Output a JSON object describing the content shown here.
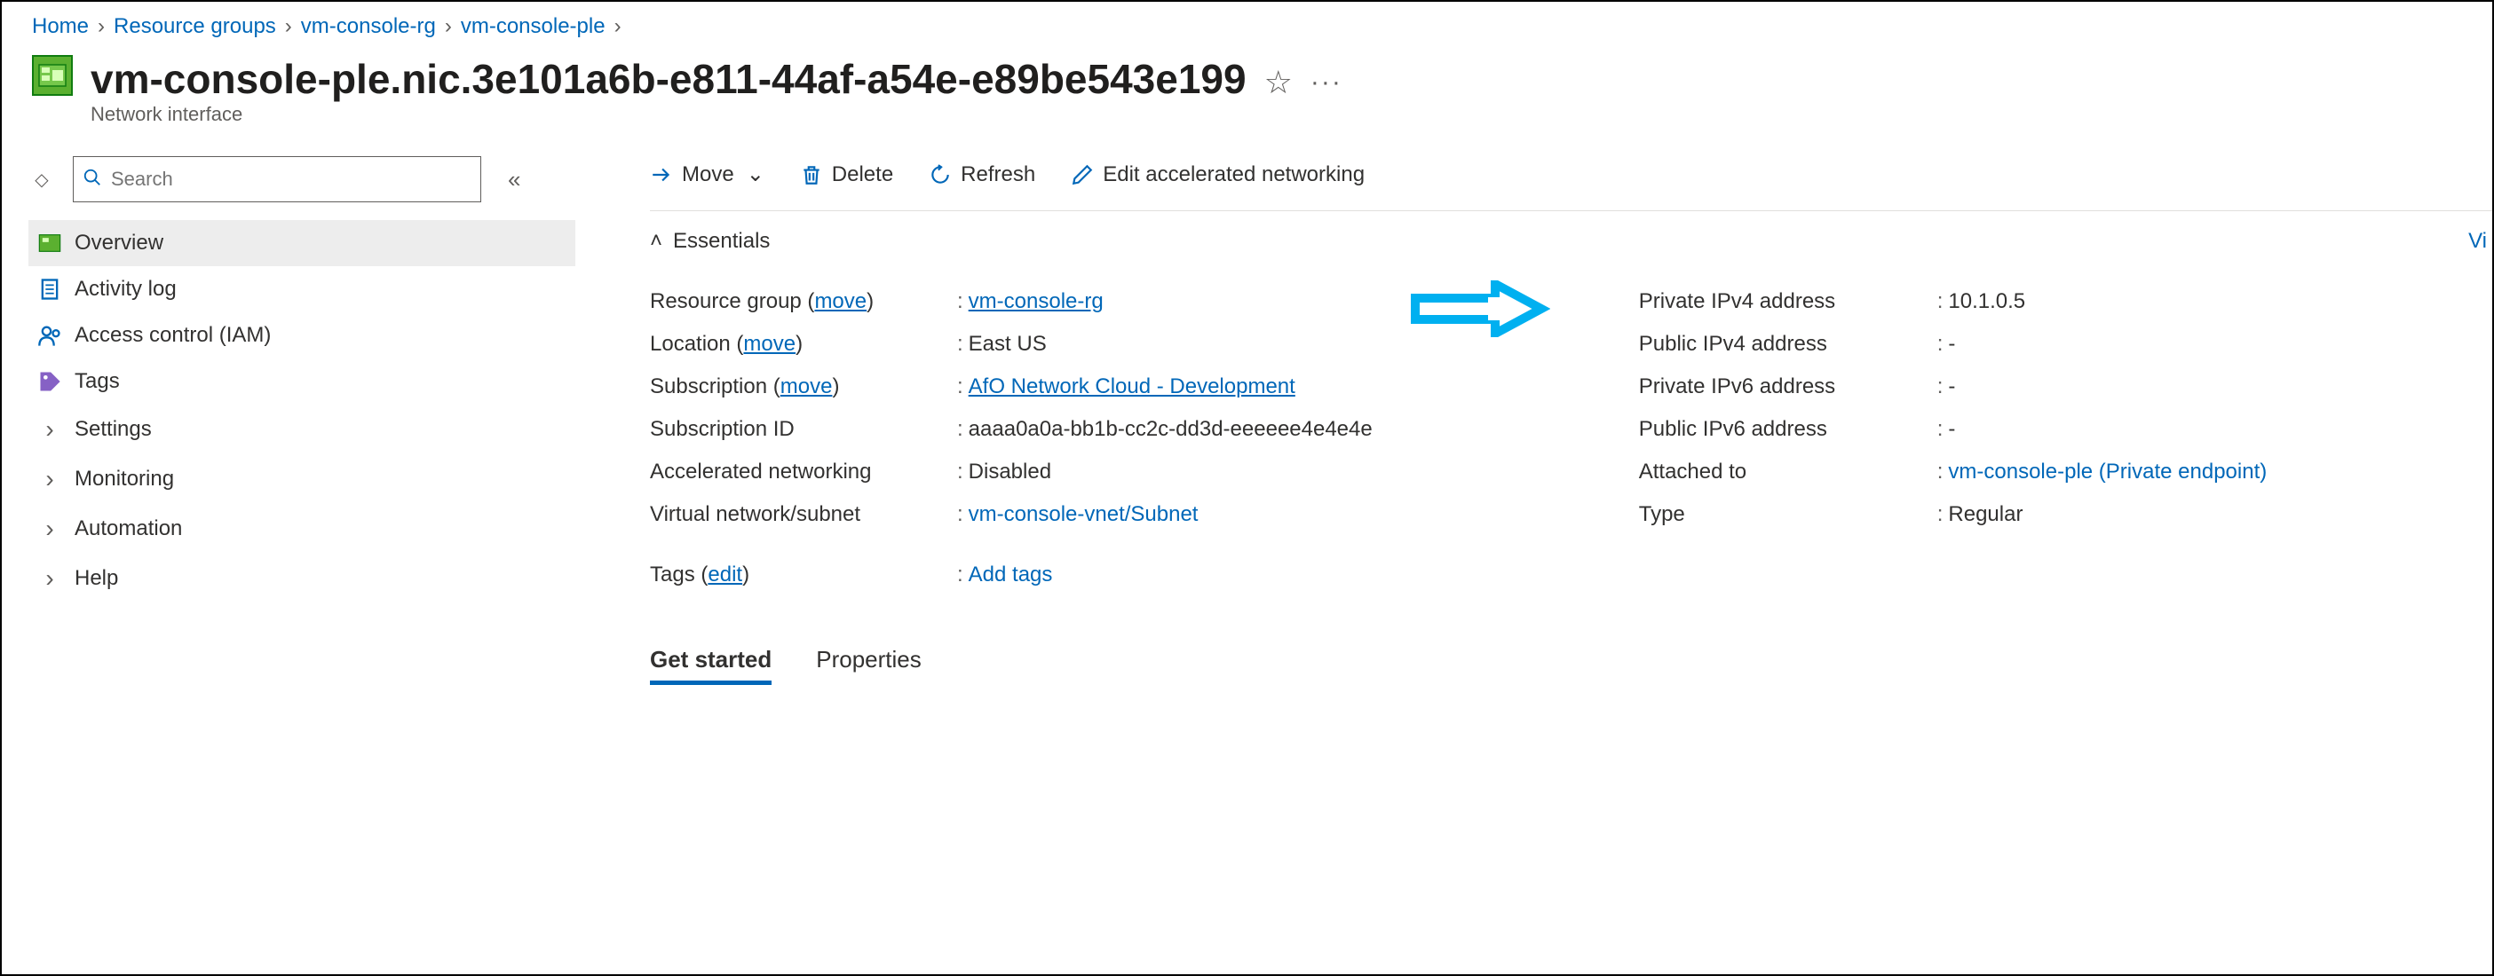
{
  "breadcrumb": [
    {
      "label": "Home"
    },
    {
      "label": "Resource groups"
    },
    {
      "label": "vm-console-rg"
    },
    {
      "label": "vm-console-ple"
    }
  ],
  "title": "vm-console-ple.nic.3e101a6b-e811-44af-a54e-e89be543e199",
  "subtitle": "Network interface",
  "sidebar": {
    "search_placeholder": "Search",
    "items": [
      {
        "label": "Overview",
        "icon": "nic-icon"
      },
      {
        "label": "Activity log",
        "icon": "log-icon"
      },
      {
        "label": "Access control (IAM)",
        "icon": "iam-icon"
      },
      {
        "label": "Tags",
        "icon": "tags-icon"
      },
      {
        "label": "Settings",
        "icon": "chevron"
      },
      {
        "label": "Monitoring",
        "icon": "chevron"
      },
      {
        "label": "Automation",
        "icon": "chevron"
      },
      {
        "label": "Help",
        "icon": "chevron"
      }
    ]
  },
  "toolbar": {
    "move": "Move",
    "delete": "Delete",
    "refresh": "Refresh",
    "edit_accel": "Edit accelerated networking"
  },
  "essentials": {
    "header": "Essentials",
    "left": {
      "resource_group_label": "Resource group",
      "resource_group_move": "move",
      "resource_group_value": "vm-console-rg",
      "location_label": "Location",
      "location_move": "move",
      "location_value": "East US",
      "subscription_label": "Subscription",
      "subscription_move": "move",
      "subscription_value": "AfO Network Cloud - Development",
      "subscription_id_label": "Subscription ID",
      "subscription_id_value": "aaaa0a0a-bb1b-cc2c-dd3d-eeeeee4e4e4e",
      "accel_label": "Accelerated networking",
      "accel_value": "Disabled",
      "vnet_label": "Virtual network/subnet",
      "vnet_value": "vm-console-vnet/Subnet",
      "tags_label": "Tags",
      "tags_edit": "edit",
      "tags_value": "Add tags"
    },
    "right": {
      "priv_ipv4_label": "Private IPv4 address",
      "priv_ipv4_value": "10.1.0.5",
      "pub_ipv4_label": "Public IPv4 address",
      "pub_ipv4_value": "-",
      "priv_ipv6_label": "Private IPv6 address",
      "priv_ipv6_value": "-",
      "pub_ipv6_label": "Public IPv6 address",
      "pub_ipv6_value": "-",
      "attached_label": "Attached to",
      "attached_value": "vm-console-ple (Private endpoint)",
      "type_label": "Type",
      "type_value": "Regular"
    }
  },
  "tabs": {
    "get_started": "Get started",
    "properties": "Properties"
  },
  "ess_right_cut": "Vi"
}
